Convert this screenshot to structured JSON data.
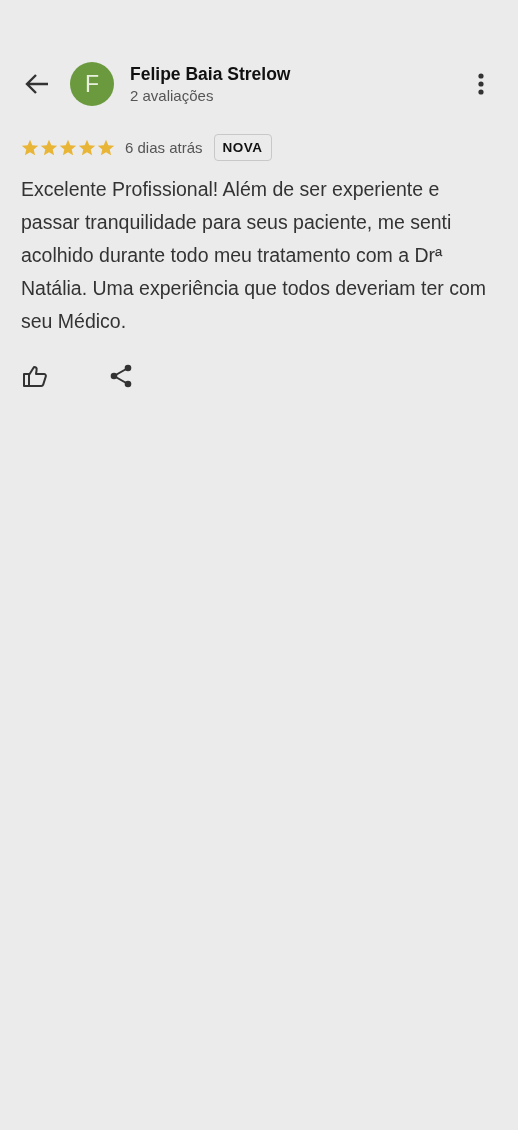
{
  "reviewer": {
    "name": "Felipe Baia Strelow",
    "initial": "F",
    "color": "#6b9a3e",
    "review_count": "2 avaliações"
  },
  "review": {
    "stars": 5,
    "time": "6 dias atrás",
    "badge": "NOVA",
    "text": "Excelente Profissional! Além de ser experiente e passar tranquilidade para seus paciente, me senti acolhido durante todo meu tratamento com a Drª Natália. Uma experiência que todos deveriam ter com seu Médico."
  }
}
